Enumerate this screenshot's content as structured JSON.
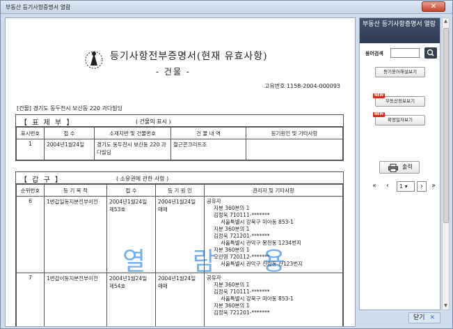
{
  "window": {
    "title": "부동산 등기사항증명서 열람",
    "close_glyph": "✕"
  },
  "document": {
    "title": "등기사항전부증명서(현재 유효사항)",
    "subtitle": "- 건물 -",
    "reg_no": "고유번호 1158-2004-000093",
    "building_line": "[건물] 경기도 동두천시 보산동 220 과다빌딩",
    "pyojebu": {
      "title": "【  표   제   부  】",
      "sub": "( 건물의 표시 )",
      "headers": [
        "표시번호",
        "접  수",
        "소재지번 및 건물번호",
        "건 물 내 역",
        "등기원인 및 기타사항"
      ],
      "rows": [
        [
          "1",
          "2004년1월24일",
          "경기도 동두천시 보산동 220 과다빌딩",
          "철근콘크리트조",
          ""
        ]
      ]
    },
    "gapgu": {
      "title": "【  갑          구  】",
      "sub": "( 소유권에 관한 사항 )",
      "headers": [
        "순위번호",
        "등 기 목 적",
        "접  수",
        "등 기 원 인",
        "권리자 및 기타사항"
      ],
      "rows": [
        {
          "no": "6",
          "purpose": "1번갑일동지분전부이전",
          "receipt": "2004년1월24일\n제53호",
          "cause": "2004년1월24일\n매매",
          "rights": [
            "공유자",
            "  지분 360분의 1",
            "  김정욱   710111-*******",
            "    서울특별시 강북구 미아동 853-1",
            "  지분 360분의 1",
            "  김정욱   721201-*******",
            "    서울특별시 관악구 봉천동 1234번지",
            "  지분 360분의 1",
            "  오민영   720112-*******",
            "    서울특별시 관악구 신림동 산123번지"
          ]
        },
        {
          "no": "7",
          "purpose": "1번갑이동지분전부이전",
          "receipt": "2004년1월24일\n제54호",
          "cause": "2004년1월24일\n매매",
          "rights": [
            "공유자",
            "  지분 360분의 1",
            "  김정욱   710111-*******",
            "    서울특별시 강북구 미아동 853-1",
            "  지분 360분의 1",
            "  김정욱   721201-*******"
          ]
        }
      ]
    },
    "watermark": "열 람 용"
  },
  "sidebar": {
    "heading": "부동산 등기사항증명서 열람",
    "search_label": "용어검색",
    "search_value": "",
    "glossary_button": "등기용어해설보기",
    "real_estate_button": "부동산정보보기",
    "confirm_date_button": "확정일자보기",
    "new_badge": "NEW",
    "print_label": "출력",
    "page_value": "1"
  },
  "footer": {
    "close_label": "닫기"
  }
}
